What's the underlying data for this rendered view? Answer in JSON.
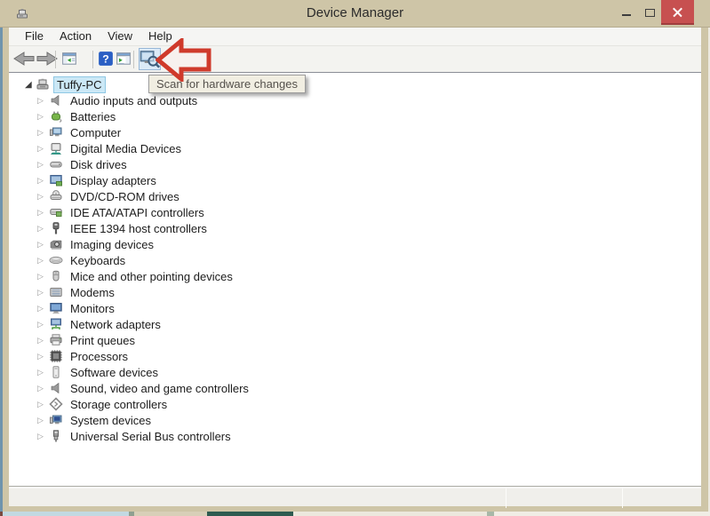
{
  "window": {
    "title": "Device Manager"
  },
  "menu": {
    "items": [
      "File",
      "Action",
      "View",
      "Help"
    ]
  },
  "toolbar": {
    "buttons": [
      {
        "name": "back",
        "icon": "arrow-left-icon"
      },
      {
        "name": "forward",
        "icon": "arrow-right-icon"
      },
      {
        "name": "show-console-tree",
        "icon": "console-tree-icon"
      },
      {
        "name": "help",
        "icon": "help-icon"
      },
      {
        "name": "show-action-pane",
        "icon": "action-pane-icon"
      },
      {
        "name": "scan-for-hardware-changes",
        "icon": "scan-hardware-icon",
        "active": true
      }
    ],
    "tooltip": "Scan for hardware changes"
  },
  "annotation": {
    "shape": "block-arrow-left",
    "points_at": "scan-for-hardware-changes"
  },
  "glyphs": {
    "expanded": "◢",
    "collapsed": "▷",
    "help": "?"
  },
  "tree": {
    "root": {
      "label": "Tuffy-PC",
      "selected": true,
      "expanded": true,
      "icon": "computer-root-icon"
    },
    "items": [
      {
        "label": "Audio inputs and outputs",
        "icon": "audio-icon"
      },
      {
        "label": "Batteries",
        "icon": "battery-icon"
      },
      {
        "label": "Computer",
        "icon": "computer-icon"
      },
      {
        "label": "Digital Media Devices",
        "icon": "media-device-icon"
      },
      {
        "label": "Disk drives",
        "icon": "disk-drive-icon"
      },
      {
        "label": "Display adapters",
        "icon": "display-adapter-icon"
      },
      {
        "label": "DVD/CD-ROM drives",
        "icon": "optical-drive-icon"
      },
      {
        "label": "IDE ATA/ATAPI controllers",
        "icon": "ide-controller-icon"
      },
      {
        "label": "IEEE 1394 host controllers",
        "icon": "firewire-icon"
      },
      {
        "label": "Imaging devices",
        "icon": "imaging-icon"
      },
      {
        "label": "Keyboards",
        "icon": "keyboard-icon"
      },
      {
        "label": "Mice and other pointing devices",
        "icon": "mouse-icon"
      },
      {
        "label": "Modems",
        "icon": "modem-icon"
      },
      {
        "label": "Monitors",
        "icon": "monitor-icon"
      },
      {
        "label": "Network adapters",
        "icon": "network-adapter-icon"
      },
      {
        "label": "Print queues",
        "icon": "printer-icon"
      },
      {
        "label": "Processors",
        "icon": "cpu-icon"
      },
      {
        "label": "Software devices",
        "icon": "software-device-icon"
      },
      {
        "label": "Sound, video and game controllers",
        "icon": "sound-icon"
      },
      {
        "label": "Storage controllers",
        "icon": "storage-controller-icon"
      },
      {
        "label": "System devices",
        "icon": "system-device-icon"
      },
      {
        "label": "Universal Serial Bus controllers",
        "icon": "usb-icon"
      }
    ]
  },
  "statusbar": {
    "text": ""
  },
  "colors": {
    "titlebar-bg": "#cec5a7",
    "close-red": "#c75050",
    "sel-bg": "#cbe8f6",
    "scan-hl": "#dceaf7",
    "tooltip-bg": "#f1eee2",
    "annotation-red": "#cf3a2b",
    "sliver-teal": "#2e5b50",
    "sliver-blue": "#c2d9e2"
  }
}
